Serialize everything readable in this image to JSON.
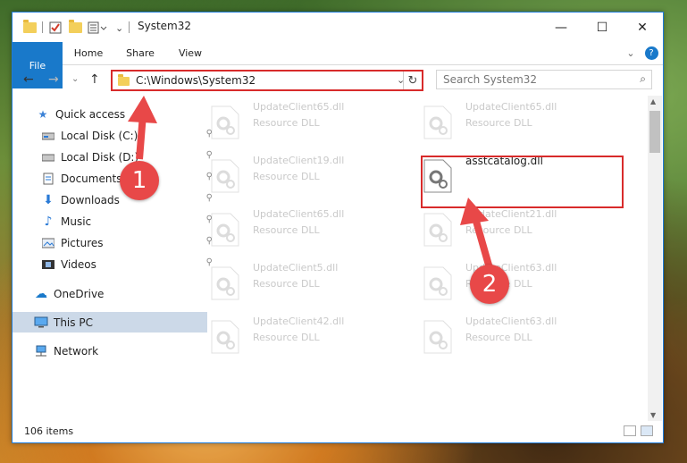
{
  "window": {
    "title": "System32",
    "controls": {
      "minimize": "—",
      "maximize": "☐",
      "close": "✕"
    }
  },
  "ribbon": {
    "tabs": [
      "File",
      "Home",
      "Share",
      "View"
    ],
    "expand": "⌄",
    "help": "?"
  },
  "nav": {
    "back": "←",
    "forward": "→",
    "recent": "⌄",
    "up": "↑",
    "address": "C:\\Windows\\System32",
    "address_dropdown": "⌄",
    "refresh": "↻",
    "search_placeholder": "Search System32",
    "search_icon": "⌕"
  },
  "sidebar": {
    "items": [
      {
        "label": "Quick access",
        "icon": "star-icon",
        "pinned": false
      },
      {
        "label": "Local Disk (C:)",
        "icon": "drive-icon",
        "pinned": true
      },
      {
        "label": "Local Disk (D:)",
        "icon": "drive-icon",
        "pinned": true
      },
      {
        "label": "Documents",
        "icon": "documents-icon",
        "pinned": true
      },
      {
        "label": "Downloads",
        "icon": "downloads-icon",
        "pinned": true
      },
      {
        "label": "Music",
        "icon": "music-icon",
        "pinned": true
      },
      {
        "label": "Pictures",
        "icon": "pictures-icon",
        "pinned": true
      },
      {
        "label": "Videos",
        "icon": "videos-icon",
        "pinned": true
      },
      {
        "label": "OneDrive",
        "icon": "cloud-icon",
        "pinned": false
      },
      {
        "label": "This PC",
        "icon": "computer-icon",
        "pinned": false,
        "selected": true
      },
      {
        "label": "Network",
        "icon": "network-icon",
        "pinned": false
      }
    ],
    "pin_glyph": "📌"
  },
  "files": [
    {
      "name": "UpdateClient65.dll",
      "type": "Resource DLL"
    },
    {
      "name": "UpdateClient65.dll",
      "type": "Resource DLL"
    },
    {
      "name": "UpdateClient19.dll",
      "type": "Resource DLL"
    },
    {
      "name": "asstcatalog.dll",
      "type": ""
    },
    {
      "name": "UpdateClient65.dll",
      "type": "Resource DLL"
    },
    {
      "name": "UpdateClient21.dll",
      "type": "Resource DLL"
    },
    {
      "name": "UpdateClient5.dll",
      "type": "Resource DLL"
    },
    {
      "name": "UpdateClient63.dll",
      "type": "Resource DLL"
    },
    {
      "name": "UpdateClient42.dll",
      "type": "Resource DLL"
    },
    {
      "name": "UpdateClient63.dll",
      "type": "Resource DLL"
    }
  ],
  "status": {
    "item_count": "106 items"
  },
  "annotations": {
    "step1": "1",
    "step2": "2",
    "arrow_color": "#e84848",
    "box_color": "#d82b2b"
  }
}
